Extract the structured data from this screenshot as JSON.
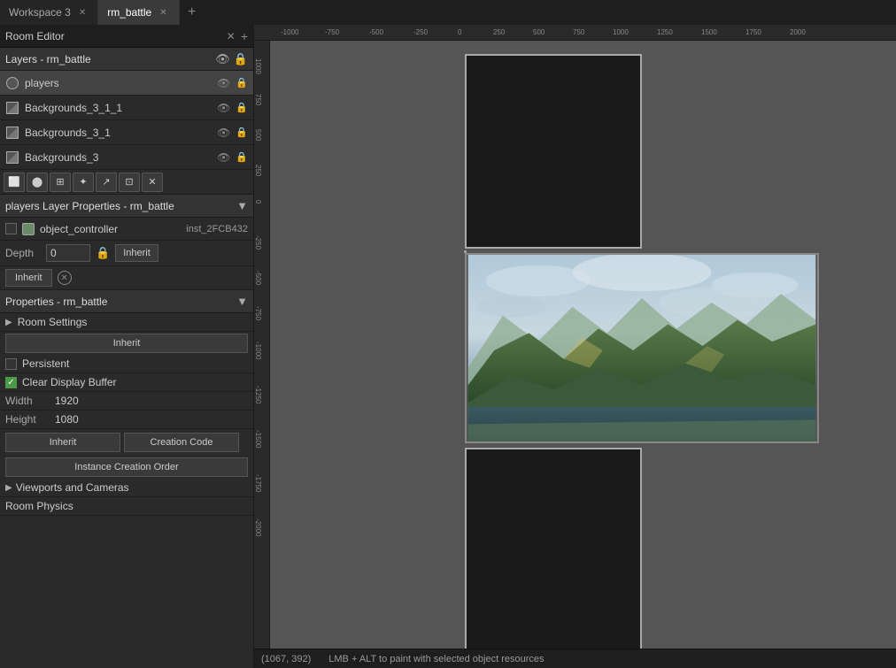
{
  "tabs": [
    {
      "label": "Workspace 3",
      "active": false,
      "closeable": true
    },
    {
      "label": "rm_battle",
      "active": true,
      "closeable": true
    }
  ],
  "tab_add": "+",
  "room_editor": {
    "title": "Room Editor",
    "layers_title": "Layers - rm_battle",
    "layers": [
      {
        "name": "players",
        "type": "object",
        "selected": true
      },
      {
        "name": "Backgrounds_3_1_1",
        "type": "background",
        "selected": false
      },
      {
        "name": "Backgrounds_3_1",
        "type": "background",
        "selected": false
      },
      {
        "name": "Backgrounds_3",
        "type": "background",
        "selected": false
      }
    ],
    "layer_props_title": "players Layer Properties - rm_battle",
    "instance": {
      "name": "object_controller",
      "id": "inst_2FCB432"
    },
    "depth_label": "Depth",
    "depth_value": "0",
    "inherit_btn": "Inherit",
    "props_title": "Properties - rm_battle",
    "room_settings_label": "Room Settings",
    "persistent_label": "Persistent",
    "persistent_checked": false,
    "clear_display_label": "Clear Display Buffer",
    "clear_display_checked": true,
    "width_label": "Width",
    "width_value": "1920",
    "height_label": "Height",
    "height_value": "1080",
    "creation_code_btn": "Creation Code",
    "instance_creation_order_btn": "Instance Creation Order",
    "viewports_label": "Viewports and Cameras",
    "room_physics_label": "Room Physics"
  },
  "ruler": {
    "top_ticks": [
      "-1000",
      "-750",
      "-500",
      "-250",
      "0",
      "250",
      "500",
      "750",
      "1000",
      "1250",
      "1500",
      "1750",
      "2000"
    ],
    "left_ticks": [
      "1000",
      "750",
      "500",
      "250",
      "0",
      "-250",
      "-500",
      "-750",
      "-1000",
      "-1250",
      "-1500",
      "-1750",
      "-2000"
    ]
  },
  "status": {
    "coords": "(1067, 392)",
    "hint": "LMB + ALT to paint with selected object resources"
  },
  "toolbar": {
    "tools": [
      "⬜",
      "⬤",
      "⊞",
      "✦",
      "↗",
      "⊡",
      "✕"
    ]
  }
}
